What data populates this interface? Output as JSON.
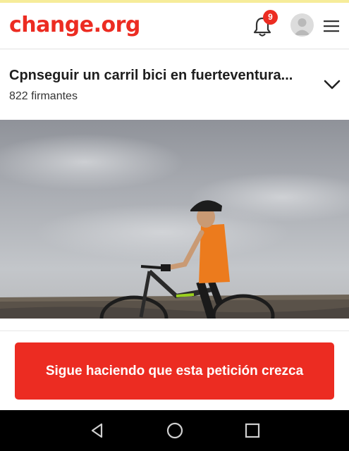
{
  "header": {
    "logo_text": "change.org",
    "notification_count": "9",
    "brand_color": "#ec2c22"
  },
  "petition": {
    "title": "Cpnseguir un carril bici en fuerteventura...",
    "signers": "822 firmantes"
  },
  "cta": {
    "label": "Sigue haciendo que esta petición crezca"
  },
  "icons": {
    "bell": "bell-icon",
    "avatar": "user-avatar-icon",
    "menu": "hamburger-menu-icon",
    "chevron": "chevron-down-icon",
    "nav_back": "back-triangle-icon",
    "nav_home": "home-circle-icon",
    "nav_recents": "recents-square-icon"
  }
}
